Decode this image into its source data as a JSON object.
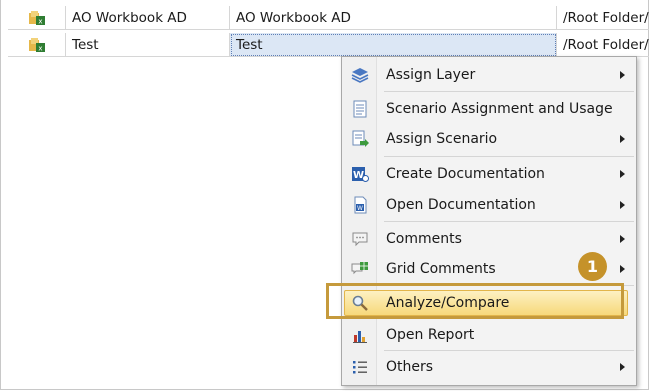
{
  "grid": {
    "rows": [
      {
        "name": "AO Workbook AD",
        "description": "AO Workbook AD",
        "path": "/Root Folder/b"
      },
      {
        "name": "Test",
        "description": "Test",
        "path": "/Root Folder/b"
      }
    ]
  },
  "context_menu": {
    "items": [
      {
        "label": "Assign Layer",
        "icon": "layers-icon",
        "submenu": true
      },
      {
        "label": "Scenario Assignment and Usage",
        "icon": "document-list-icon",
        "submenu": false
      },
      {
        "label": "Assign Scenario",
        "icon": "assign-scenario-icon",
        "submenu": true
      },
      {
        "label": "Create Documentation",
        "icon": "word-create-icon",
        "submenu": true
      },
      {
        "label": "Open Documentation",
        "icon": "word-document-icon",
        "submenu": true
      },
      {
        "label": "Comments",
        "icon": "comment-bubble-icon",
        "submenu": true
      },
      {
        "label": "Grid Comments",
        "icon": "grid-comment-icon",
        "submenu": true
      },
      {
        "label": "Analyze/Compare",
        "icon": "magnifier-icon",
        "submenu": false,
        "highlighted": true
      },
      {
        "label": "Open Report",
        "icon": "report-chart-icon",
        "submenu": false
      },
      {
        "label": "Others",
        "icon": "list-icon",
        "submenu": true
      }
    ]
  },
  "callout": {
    "number": "1"
  },
  "colors": {
    "highlight": "#f7d97b",
    "callout": "#c59a3c",
    "selection": "#dce7f5"
  }
}
